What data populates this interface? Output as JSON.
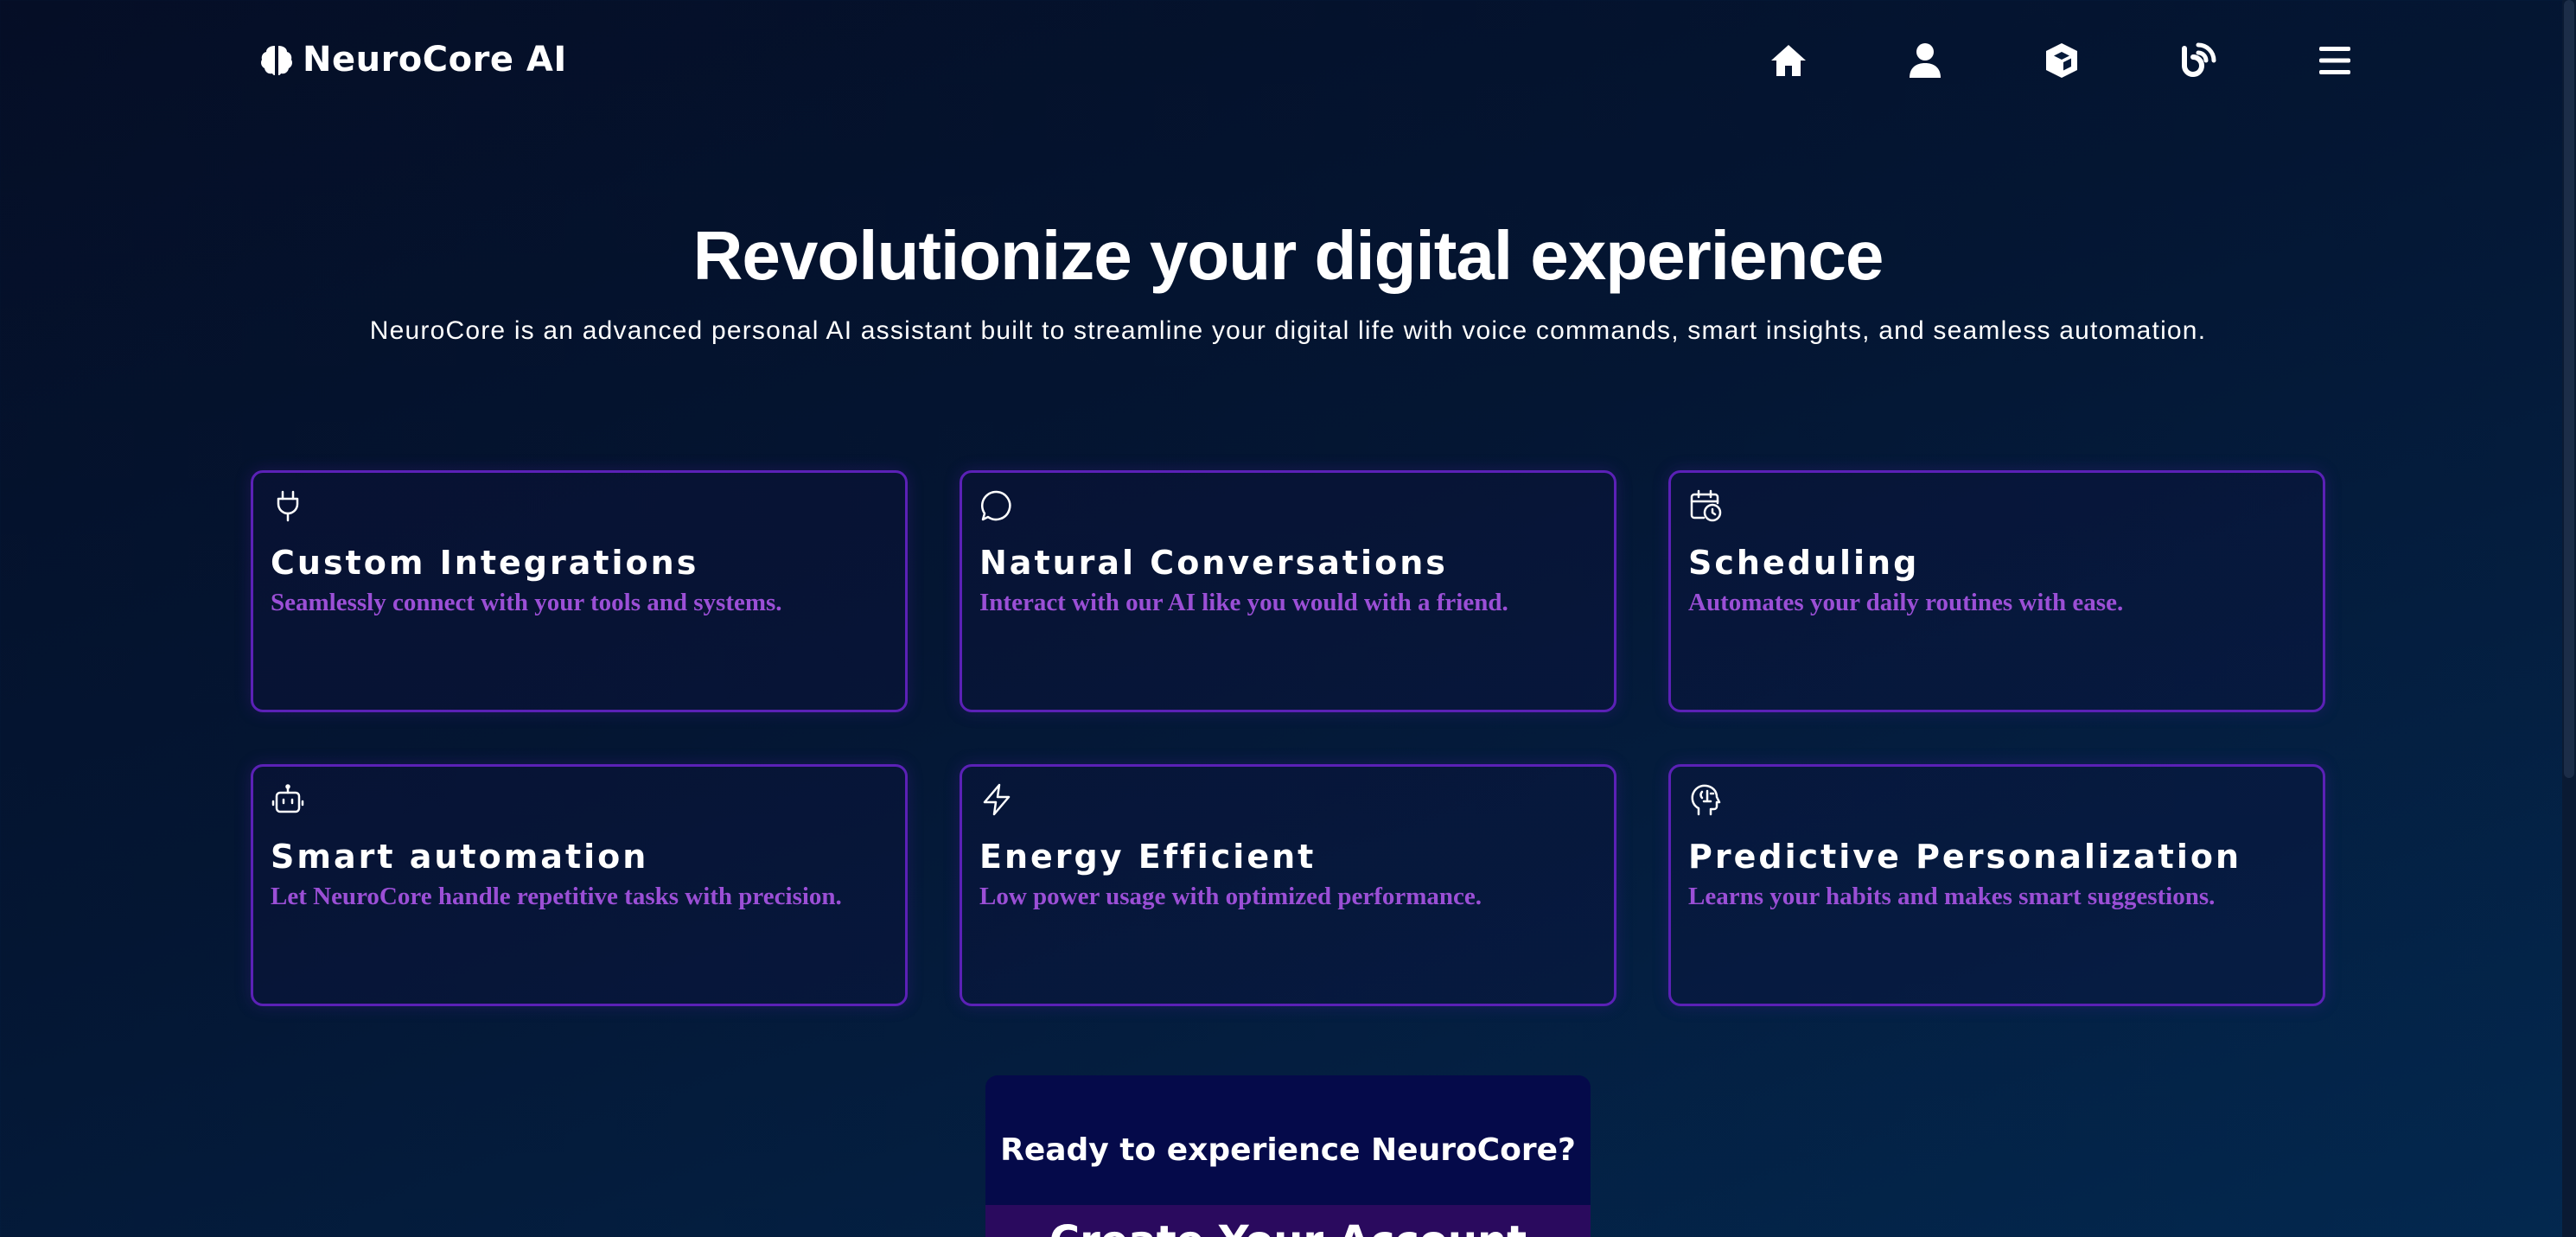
{
  "header": {
    "logo_text": "NeuroCore AI",
    "logo_icon": "brain-icon",
    "nav": [
      {
        "icon": "home-icon"
      },
      {
        "icon": "user-icon"
      },
      {
        "icon": "cube-icon"
      },
      {
        "icon": "blog-icon"
      },
      {
        "icon": "menu-icon"
      }
    ]
  },
  "hero": {
    "title": "Revolutionize your digital experience",
    "subtitle": "NeuroCore is an advanced personal AI assistant built to streamline your digital life with voice commands, smart insights, and seamless automation."
  },
  "features": [
    {
      "icon": "plug-icon",
      "title": "Custom Integrations",
      "description": "Seamlessly connect with your tools and systems."
    },
    {
      "icon": "chat-bubble-icon",
      "title": "Natural Conversations",
      "description": "Interact with our AI like you would with a friend."
    },
    {
      "icon": "calendar-clock-icon",
      "title": "Scheduling",
      "description": "Automates your daily routines with ease."
    },
    {
      "icon": "robot-icon",
      "title": "Smart automation",
      "description": "Let NeuroCore handle repetitive tasks with precision."
    },
    {
      "icon": "lightning-icon",
      "title": "Energy Efficient",
      "description": "Low power usage with optimized performance."
    },
    {
      "icon": "brain-head-icon",
      "title": "Predictive Personalization",
      "description": "Learns your habits and makes smart suggestions."
    }
  ],
  "cta": {
    "title": "Ready to experience NeuroCore?",
    "button_label": "Create Your Account"
  },
  "colors": {
    "accent_border": "#5b21b6",
    "description_text": "#9b4fd6",
    "background_start": "#050e26",
    "background_end": "#03284f",
    "cta_background": "#050a4a"
  }
}
